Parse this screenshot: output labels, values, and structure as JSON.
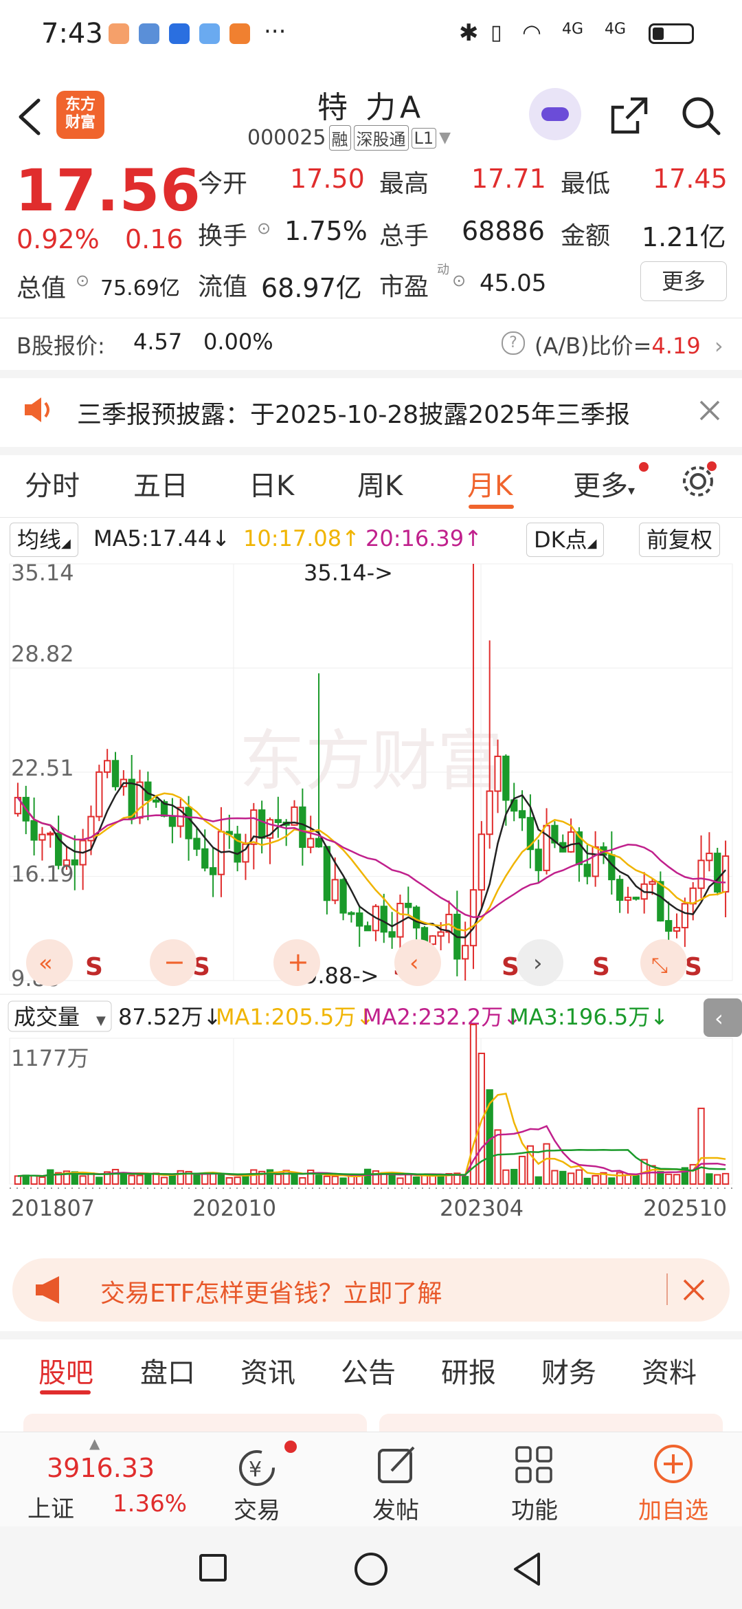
{
  "status_bar": {
    "time": "7:43",
    "dots": "···",
    "signal1": "4G",
    "signal2": "4G"
  },
  "header": {
    "logo_line1": "东方",
    "logo_line2": "财富",
    "stock_name": "特 力A",
    "stock_code": "000025",
    "tags": [
      "融",
      "深股通",
      "L1"
    ]
  },
  "quote": {
    "price": "17.56",
    "change_pct": "0.92%",
    "change_abs": "0.16",
    "open_label": "今开",
    "open": "17.50",
    "high_label": "最高",
    "high": "17.71",
    "low_label": "最低",
    "low": "17.45",
    "turnover_label": "换手",
    "turnover": "1.75%",
    "volume_label": "总手",
    "volume": "68886",
    "amount_label": "金额",
    "amount": "1.21亿",
    "mcap_label": "总值",
    "mcap": "75.69亿",
    "float_label": "流值",
    "float_cap": "68.97亿",
    "pe_label": "市盈",
    "pe_sup": "动",
    "pe": "45.05",
    "more_button": "更多"
  },
  "bshare": {
    "label": "B股报价:",
    "price": "4.57",
    "pct": "0.00%",
    "ratio_label": "(A/B)比价=",
    "ratio": "4.19"
  },
  "notice": {
    "text": "三季报预披露：于2025-10-28披露2025年三季报"
  },
  "chart_tabs": [
    "分时",
    "五日",
    "日K",
    "周K",
    "月K",
    "更多"
  ],
  "indicators": {
    "ma_select": "均线",
    "ma5": "MA5:17.44↓",
    "ma10": "10:17.08↑",
    "ma20": "20:16.39↑",
    "dk": "DK点",
    "adjust": "前复权"
  },
  "kline": {
    "y_labels": [
      "35.14",
      "28.82",
      "22.51",
      "16.19",
      "9.88"
    ],
    "max_annot": "35.14->",
    "min_annot": "9.88->",
    "signal": "S",
    "watermark": "东方财富"
  },
  "volume": {
    "select": "成交量",
    "current": "87.52万↓",
    "ma1": "MA1:205.5万↓",
    "ma2": "MA2:232.2万↓",
    "ma3": "MA3:196.5万↓",
    "max_label": "1177万",
    "x_labels": [
      "201807",
      "202010",
      "202304",
      "202510"
    ]
  },
  "chart_data": {
    "type": "candlestick",
    "y_range": [
      9.88,
      35.14
    ],
    "x_range": [
      "201807",
      "202510"
    ],
    "max_point": 35.14,
    "min_point": 9.88,
    "volume_max": "1177万"
  },
  "banner": {
    "text": "交易ETF怎样更省钱？立即了解"
  },
  "bottom_tabs": [
    "股吧",
    "盘口",
    "资讯",
    "公告",
    "研报",
    "财务",
    "资料"
  ],
  "bottom_nav": {
    "index_value": "3916.33",
    "index_name": "上证",
    "index_pct": "1.36%",
    "trade": "交易",
    "post": "发帖",
    "function": "功能",
    "add": "加自选"
  },
  "colors": {
    "up": "#e02d2d",
    "down": "#1a9a2a",
    "accent": "#f0642d",
    "ma5": "#222222",
    "ma10": "#f0b400",
    "ma20": "#c0208c"
  }
}
